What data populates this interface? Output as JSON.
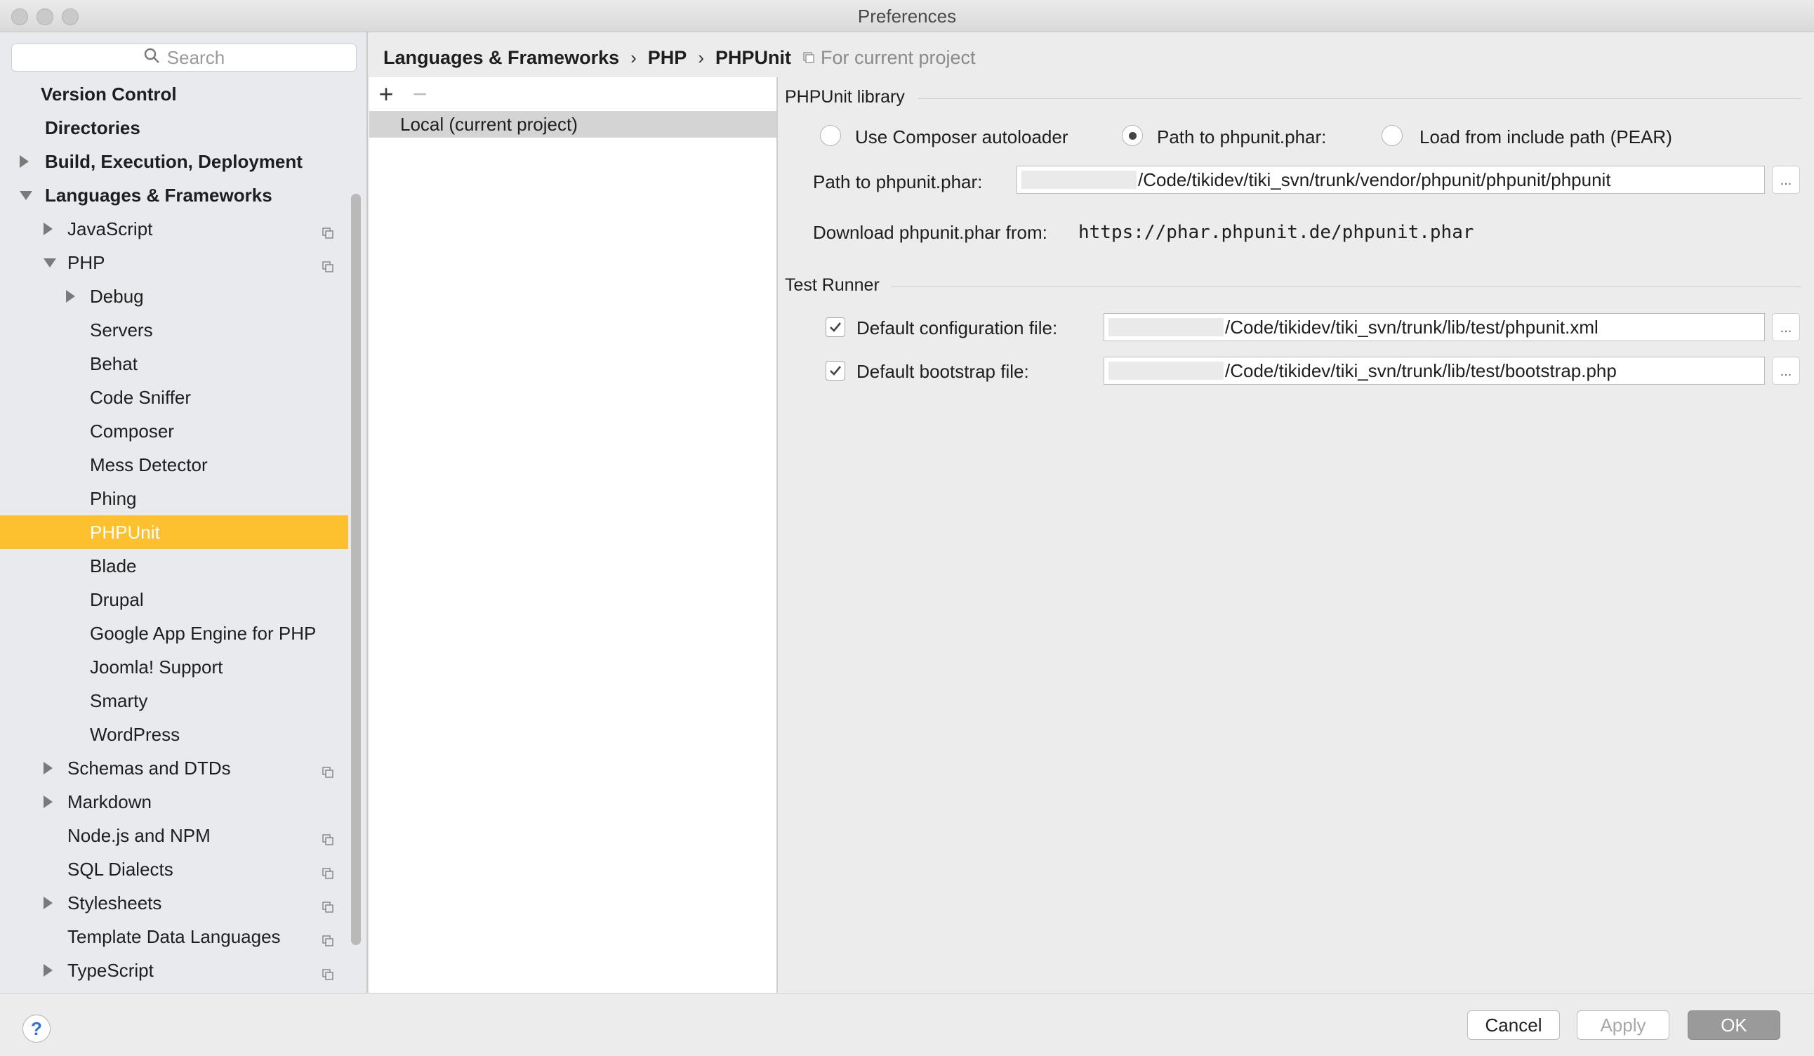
{
  "window": {
    "title": "Preferences"
  },
  "search": {
    "placeholder": "Search"
  },
  "sidebar": {
    "items": [
      {
        "label": "Version Control",
        "level": 0,
        "bold": true,
        "arrow": "none",
        "project_icon": false
      },
      {
        "label": "Directories",
        "level": 0,
        "bold": true,
        "arrow": "none",
        "project_icon": false
      },
      {
        "label": "Build, Execution, Deployment",
        "level": 0,
        "bold": true,
        "arrow": "right",
        "project_icon": false
      },
      {
        "label": "Languages & Frameworks",
        "level": 0,
        "bold": true,
        "arrow": "down",
        "project_icon": false
      },
      {
        "label": "JavaScript",
        "level": 1,
        "bold": false,
        "arrow": "right",
        "project_icon": true
      },
      {
        "label": "PHP",
        "level": 1,
        "bold": false,
        "arrow": "down",
        "project_icon": true
      },
      {
        "label": "Debug",
        "level": 2,
        "bold": false,
        "arrow": "right",
        "project_icon": false
      },
      {
        "label": "Servers",
        "level": 2,
        "bold": false,
        "arrow": "none",
        "project_icon": false
      },
      {
        "label": "Behat",
        "level": 2,
        "bold": false,
        "arrow": "none",
        "project_icon": false
      },
      {
        "label": "Code Sniffer",
        "level": 2,
        "bold": false,
        "arrow": "none",
        "project_icon": false
      },
      {
        "label": "Composer",
        "level": 2,
        "bold": false,
        "arrow": "none",
        "project_icon": false
      },
      {
        "label": "Mess Detector",
        "level": 2,
        "bold": false,
        "arrow": "none",
        "project_icon": false
      },
      {
        "label": "Phing",
        "level": 2,
        "bold": false,
        "arrow": "none",
        "project_icon": false
      },
      {
        "label": "PHPUnit",
        "level": 2,
        "bold": false,
        "arrow": "none",
        "project_icon": false,
        "selected": true
      },
      {
        "label": "Blade",
        "level": 2,
        "bold": false,
        "arrow": "none",
        "project_icon": false
      },
      {
        "label": "Drupal",
        "level": 2,
        "bold": false,
        "arrow": "none",
        "project_icon": false
      },
      {
        "label": "Google App Engine for PHP",
        "level": 2,
        "bold": false,
        "arrow": "none",
        "project_icon": false
      },
      {
        "label": "Joomla! Support",
        "level": 2,
        "bold": false,
        "arrow": "none",
        "project_icon": false
      },
      {
        "label": "Smarty",
        "level": 2,
        "bold": false,
        "arrow": "none",
        "project_icon": false
      },
      {
        "label": "WordPress",
        "level": 2,
        "bold": false,
        "arrow": "none",
        "project_icon": false
      },
      {
        "label": "Schemas and DTDs",
        "level": 1,
        "bold": false,
        "arrow": "right",
        "project_icon": true
      },
      {
        "label": "Markdown",
        "level": 1,
        "bold": false,
        "arrow": "right",
        "project_icon": false
      },
      {
        "label": "Node.js and NPM",
        "level": 1,
        "bold": false,
        "arrow": "none",
        "project_icon": true
      },
      {
        "label": "SQL Dialects",
        "level": 1,
        "bold": false,
        "arrow": "none",
        "project_icon": true
      },
      {
        "label": "Stylesheets",
        "level": 1,
        "bold": false,
        "arrow": "right",
        "project_icon": true
      },
      {
        "label": "Template Data Languages",
        "level": 1,
        "bold": false,
        "arrow": "none",
        "project_icon": true
      },
      {
        "label": "TypeScript",
        "level": 1,
        "bold": false,
        "arrow": "right",
        "project_icon": true
      }
    ]
  },
  "breadcrumb": {
    "parts": [
      "Languages & Frameworks",
      "PHP",
      "PHPUnit"
    ],
    "separator": "›",
    "scope": "For current project"
  },
  "interpreters": {
    "add_symbol": "+",
    "remove_symbol": "−",
    "items": [
      "Local (current project)"
    ]
  },
  "phpunit_library": {
    "title": "PHPUnit library",
    "options": [
      {
        "label": "Use Composer autoloader",
        "checked": false
      },
      {
        "label": "Path to phpunit.phar:",
        "checked": true
      },
      {
        "label": "Load from include path (PEAR)",
        "checked": false
      }
    ],
    "path_label": "Path to phpunit.phar:",
    "path_value": "/Code/tikidev/tiki_svn/trunk/vendor/phpunit/phpunit/phpunit",
    "download_label": "Download phpunit.phar from:",
    "download_url": "https://phar.phpunit.de/phpunit.phar"
  },
  "test_runner": {
    "title": "Test Runner",
    "config": {
      "label": "Default configuration file:",
      "checked": true,
      "value": "/Code/tikidev/tiki_svn/trunk/lib/test/phpunit.xml"
    },
    "bootstrap": {
      "label": "Default bootstrap file:",
      "checked": true,
      "value": "/Code/tikidev/tiki_svn/trunk/lib/test/bootstrap.php"
    },
    "browse_label": "..."
  },
  "footer": {
    "help": "?",
    "cancel": "Cancel",
    "apply": "Apply",
    "ok": "OK"
  },
  "colors": {
    "selection": "#fdc02f",
    "panel_bg": "#ececec",
    "sidebar_bg": "#e8eaed"
  }
}
